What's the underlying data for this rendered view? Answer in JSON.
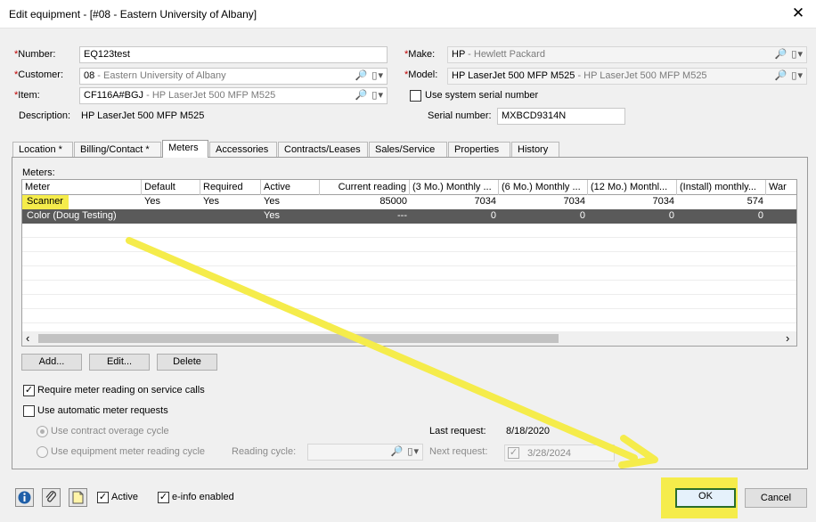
{
  "window": {
    "title": "Edit equipment - [#08 - Eastern University of Albany]",
    "close_icon": "close-icon"
  },
  "fields": {
    "number": {
      "label": "Number:",
      "value": "EQ123test"
    },
    "customer": {
      "label": "Customer:",
      "value": "08",
      "detail": " - Eastern University of Albany"
    },
    "item": {
      "label": "Item:",
      "value": "CF116A#BGJ",
      "detail": " - HP LaserJet 500 MFP M525"
    },
    "description": {
      "label": "Description:",
      "value": "HP LaserJet 500 MFP M525"
    },
    "make": {
      "label": "Make:",
      "value": "HP",
      "detail": " - Hewlett Packard"
    },
    "model": {
      "label": "Model:",
      "value": "HP LaserJet 500 MFP M525",
      "detail": " - HP LaserJet 500 MFP M525"
    },
    "use_system_serial": {
      "label": "Use system serial number",
      "checked": false
    },
    "serial": {
      "label": "Serial number:",
      "value": "MXBCD9314N"
    },
    "required_marker": "*",
    "lookup_glyphs": "🔎 ▯▾"
  },
  "tabs": [
    "Location *",
    "Billing/Contact *",
    "Meters",
    "Accessories",
    "Contracts/Leases",
    "Sales/Service",
    "Properties",
    "History"
  ],
  "meters": {
    "label": "Meters:",
    "columns": [
      "Meter",
      "Default",
      "Required",
      "Active",
      "Current reading",
      "(3 Mo.) Monthly ...",
      "(6 Mo.) Monthly ...",
      "(12 Mo.) Monthl...",
      "(Install) monthly...",
      "War"
    ],
    "rows": [
      [
        "Scanner",
        "Yes",
        "Yes",
        "Yes",
        "85000",
        "7034",
        "7034",
        "7034",
        "574"
      ],
      [
        "Color (Doug Testing)",
        "",
        "",
        "Yes",
        "---",
        "0",
        "0",
        "0",
        "0"
      ]
    ],
    "scroll_left": "‹",
    "scroll_right": "›"
  },
  "buttons": {
    "add": "Add...",
    "edit": "Edit...",
    "delete": "Delete",
    "ok": "OK",
    "cancel": "Cancel"
  },
  "options": {
    "require_reading": {
      "label": "Require meter reading on service calls",
      "checked": true
    },
    "auto_requests": {
      "label": "Use automatic meter requests",
      "checked": false
    },
    "contract_cycle": {
      "label": "Use contract overage cycle",
      "selected": true
    },
    "equipment_cycle": {
      "label": "Use equipment meter reading cycle",
      "selected": false
    },
    "reading_cycle_label": "Reading cycle:",
    "last_request_label": "Last request:",
    "last_request_value": "8/18/2020",
    "next_request_label": "Next request:",
    "next_request_value": "3/28/2024"
  },
  "footer": {
    "active": {
      "label": "Active",
      "checked": true
    },
    "einfo": {
      "label": "e-info enabled",
      "checked": true
    },
    "icons": [
      "info-icon",
      "attach-icon",
      "note-icon"
    ]
  },
  "check_glyph": "✓",
  "colors": {
    "highlight": "#f5ec4b",
    "selected_row": "#5a5a5a",
    "ok_border": "#2a6e2a",
    "required": "#c00000"
  }
}
